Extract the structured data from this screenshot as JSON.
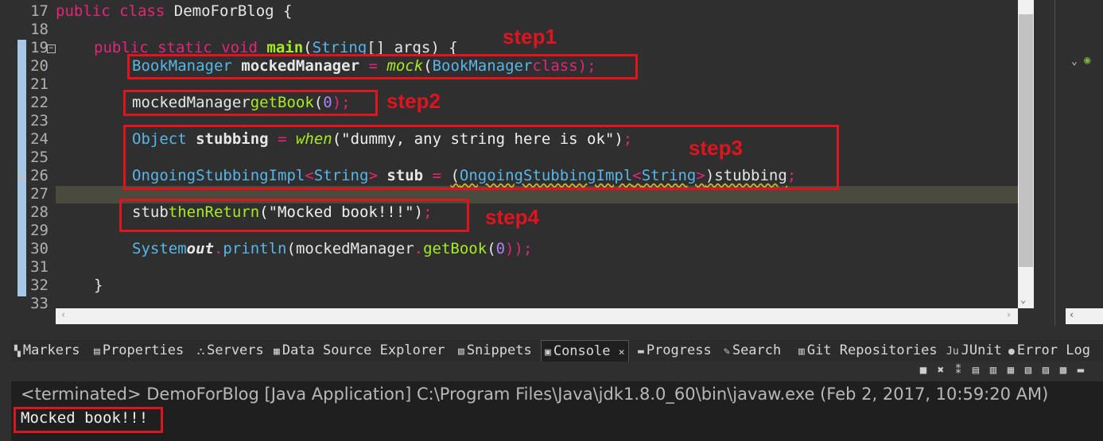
{
  "editor": {
    "line_numbers": [
      "17",
      "18",
      "19",
      "20",
      "21",
      "22",
      "23",
      "24",
      "25",
      "26",
      "27",
      "28",
      "29",
      "30",
      "31",
      "32",
      "33"
    ],
    "lines": {
      "l17": {
        "a": "public",
        "b": "class",
        "c": "DemoForBlog {"
      },
      "l19": {
        "a": "public",
        "b": "static",
        "c": "void",
        "d": "main",
        "e": "(",
        "f": "String",
        "g": "[] ",
        "h": "args",
        ") {": ") {"
      },
      "l20": {
        "a": "BookManager",
        "b": "mockedManager",
        "c": "=",
        "d": "mock",
        "e": "(",
        "f": "BookManager",
        ".": ".",
        "g": "class",
        "h": ");"
      },
      "l22": {
        "a": "mockedManager",
        ".": ".",
        "b": "getBook",
        "c": "(",
        "d": "0",
        "e": ");"
      },
      "l24": {
        "a": "Object",
        "b": "stubbing",
        "c": "=",
        "d": "when",
        "e": "(\"dummy, any string here is ok\")",
        "f": ";"
      },
      "l26": {
        "a": "OngoingStubbingImpl",
        "b": "<",
        "c": "String",
        "d": ">",
        "e": "stub",
        "f": "=",
        "g": "(",
        "h": "OngoingStubbingImpl",
        "i": "<",
        "j": "String",
        "k": ">",
        "l": ")stubbing",
        "m": ";"
      },
      "l28": {
        "a": "stub",
        ".": ".",
        "b": "thenReturn",
        "c": "(\"Mocked book!!!\")",
        "d": ";"
      },
      "l30": {
        "a": "System",
        ".": ".",
        "b": "out",
        "c": ".",
        "d": "println",
        "e": "(mockedManager",
        "f": ".",
        "g": "getBook",
        "h": "(",
        "i": "0",
        "j": "));"
      },
      "l32": {
        "a": "}"
      }
    }
  },
  "annotations": {
    "step1": "step1",
    "step2": "step2",
    "step3": "step3",
    "step4": "step4"
  },
  "tabs": [
    {
      "label": "Markers",
      "icon": "markers-icon"
    },
    {
      "label": "Properties",
      "icon": "properties-icon"
    },
    {
      "label": "Servers",
      "icon": "servers-icon"
    },
    {
      "label": "Data Source Explorer",
      "icon": "data-source-icon"
    },
    {
      "label": "Snippets",
      "icon": "snippets-icon"
    },
    {
      "label": "Console",
      "icon": "console-icon"
    },
    {
      "label": "Progress",
      "icon": "progress-icon"
    },
    {
      "label": "Search",
      "icon": "search-icon"
    },
    {
      "label": "Git Repositories",
      "icon": "git-icon"
    },
    {
      "label": "JUnit",
      "icon": "junit-icon"
    },
    {
      "label": "Error Log",
      "icon": "error-log-icon"
    }
  ],
  "console": {
    "terminated_line": "<terminated> DemoForBlog [Java Application] C:\\Program Files\\Java\\jdk1.8.0_60\\bin\\javaw.exe (Feb 2, 2017, 10:59:20 AM)",
    "output": "Mocked book!!!"
  },
  "colors": {
    "annotation_red": "#e0141e",
    "keyword": "#e3267a",
    "type": "#57b6e8",
    "method": "#a7ec21"
  }
}
